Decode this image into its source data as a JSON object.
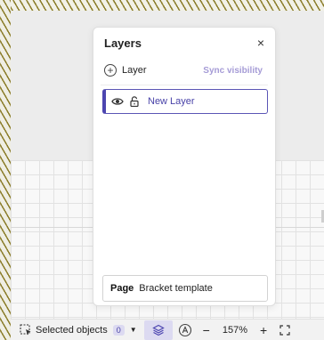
{
  "layers_panel": {
    "title": "Layers",
    "close_glyph": "×",
    "add_layer_label": "Layer",
    "sync_label": "Sync visibility",
    "layers": [
      {
        "name": "New Layer",
        "visible": true,
        "locked": false,
        "selected": true
      }
    ],
    "page": {
      "label": "Page",
      "value": "Bracket template"
    }
  },
  "bottom_bar": {
    "selected_label": "Selected objects",
    "selected_count": "0",
    "zoom_out_glyph": "−",
    "zoom_value": "157%",
    "zoom_in_glyph": "+"
  },
  "colors": {
    "accent": "#4c45b0",
    "sync_link": "#a59bd6",
    "highlight_bg": "#dcdaf1"
  }
}
